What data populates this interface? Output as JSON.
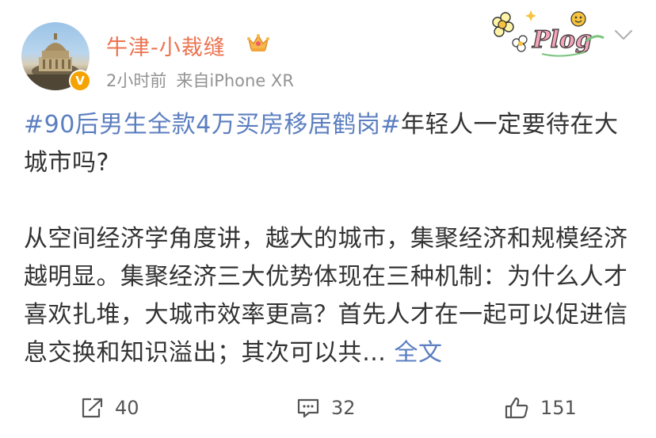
{
  "user": {
    "name": "牛津-小裁缝",
    "avatar_icon": "avatar-oxford-building",
    "verified_badge": "V",
    "crown_icon": "crown-icon"
  },
  "meta": {
    "time": "2小时前",
    "source": "来自iPhone XR"
  },
  "sticker_text": "Plog",
  "post": {
    "topic": "#90后男生全款4万买房移居鹤岗#",
    "intro": "年轻人一定要待在大城市吗?",
    "body": "从空间经济学角度讲，越大的城市，集聚经济和规模经济越明显。集聚经济三大优势体现在三种机制：为什么人才喜欢扎堆，大城市效率更高？首先人才在一起可以促进信息交换和知识溢出；其次可以共…",
    "more_label": "全文"
  },
  "actions": {
    "repost_count": "40",
    "comment_count": "32",
    "like_count": "151"
  },
  "colors": {
    "username": "#eb7350",
    "topic": "#5b7ec0",
    "meta": "#939393",
    "badge": "#f5a300"
  }
}
